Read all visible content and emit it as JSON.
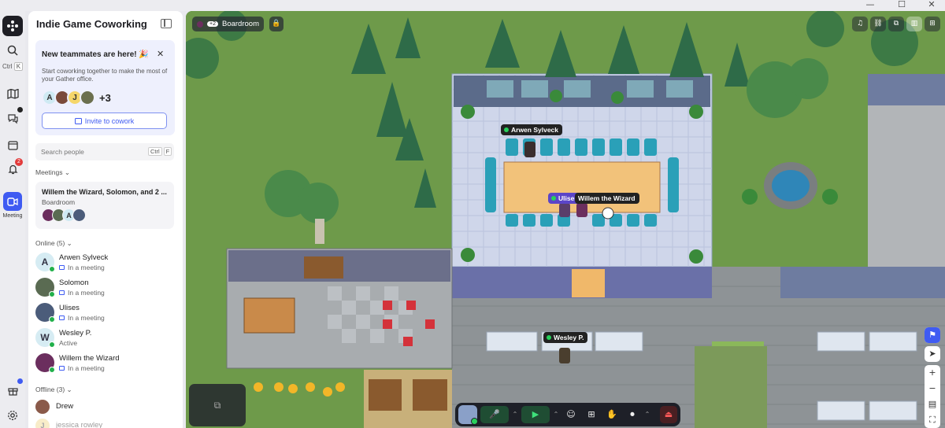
{
  "window": {
    "min": "—",
    "max": "☐",
    "close": "✕"
  },
  "rail": {
    "logo_icon": "gather-logo-icon",
    "search_kbd": [
      "Ctrl",
      "K"
    ],
    "notifications_count": "2",
    "meeting_label": "Meeting"
  },
  "sidebar": {
    "title": "Indie Game Coworking",
    "banner": {
      "title": "New teammates are here! 🎉",
      "desc": "Start coworking together to make the most of your Gather office.",
      "avatars": [
        "A",
        "",
        "J",
        ""
      ],
      "more": "+3",
      "invite": "Invite to cowork",
      "close": "✕"
    },
    "search": {
      "placeholder": "Search people",
      "kbd": [
        "Ctrl",
        "F"
      ]
    },
    "meetings_label": "Meetings ⌄",
    "meeting": {
      "title": "Willem the Wizard, Solomon, and 2 ...",
      "room": "Boardroom",
      "avatars": [
        "",
        "",
        "A",
        ""
      ]
    },
    "online_label": "Online (5) ⌄",
    "online": [
      {
        "name": "Arwen Sylveck",
        "status": "In a meeting",
        "initial": "A",
        "color": "#d6ecf3"
      },
      {
        "name": "Solomon",
        "status": "In a meeting",
        "initial": "",
        "color": "#5a6b52"
      },
      {
        "name": "Ulises",
        "status": "In a meeting",
        "initial": "",
        "color": "#4b5c7a"
      },
      {
        "name": "Wesley P.",
        "status": "Active",
        "initial": "W",
        "color": "#d6ecf3"
      },
      {
        "name": "Willem the Wizard",
        "status": "In a meeting",
        "initial": "",
        "color": "#6b2e5e"
      }
    ],
    "offline_label": "Offline (3) ⌄",
    "offline": [
      {
        "name": "Drew",
        "initial": "",
        "color": "#8a5a4a"
      },
      {
        "name": "jessica rowley",
        "initial": "J",
        "color": "#f0d68a"
      }
    ]
  },
  "map": {
    "room_pill": {
      "more": "+2",
      "name": "Boardroom"
    },
    "lock_icon": "🔒",
    "tags": [
      {
        "name": "Arwen Sylveck"
      },
      {
        "name": "Ulises"
      },
      {
        "name": "Willem the Wizard"
      },
      {
        "name": "Wesley P."
      }
    ],
    "tools": [
      "♫",
      "⛓",
      "⧉",
      "▥",
      "⊞"
    ],
    "rtools": [
      "⚑",
      "➤",
      "+",
      "−",
      "▤",
      "⛶"
    ],
    "dock": [
      "🎤",
      "⌃",
      "▶",
      "⌃",
      "☺",
      "⊞",
      "✋",
      "⏺",
      "⌃",
      "⏏"
    ]
  }
}
